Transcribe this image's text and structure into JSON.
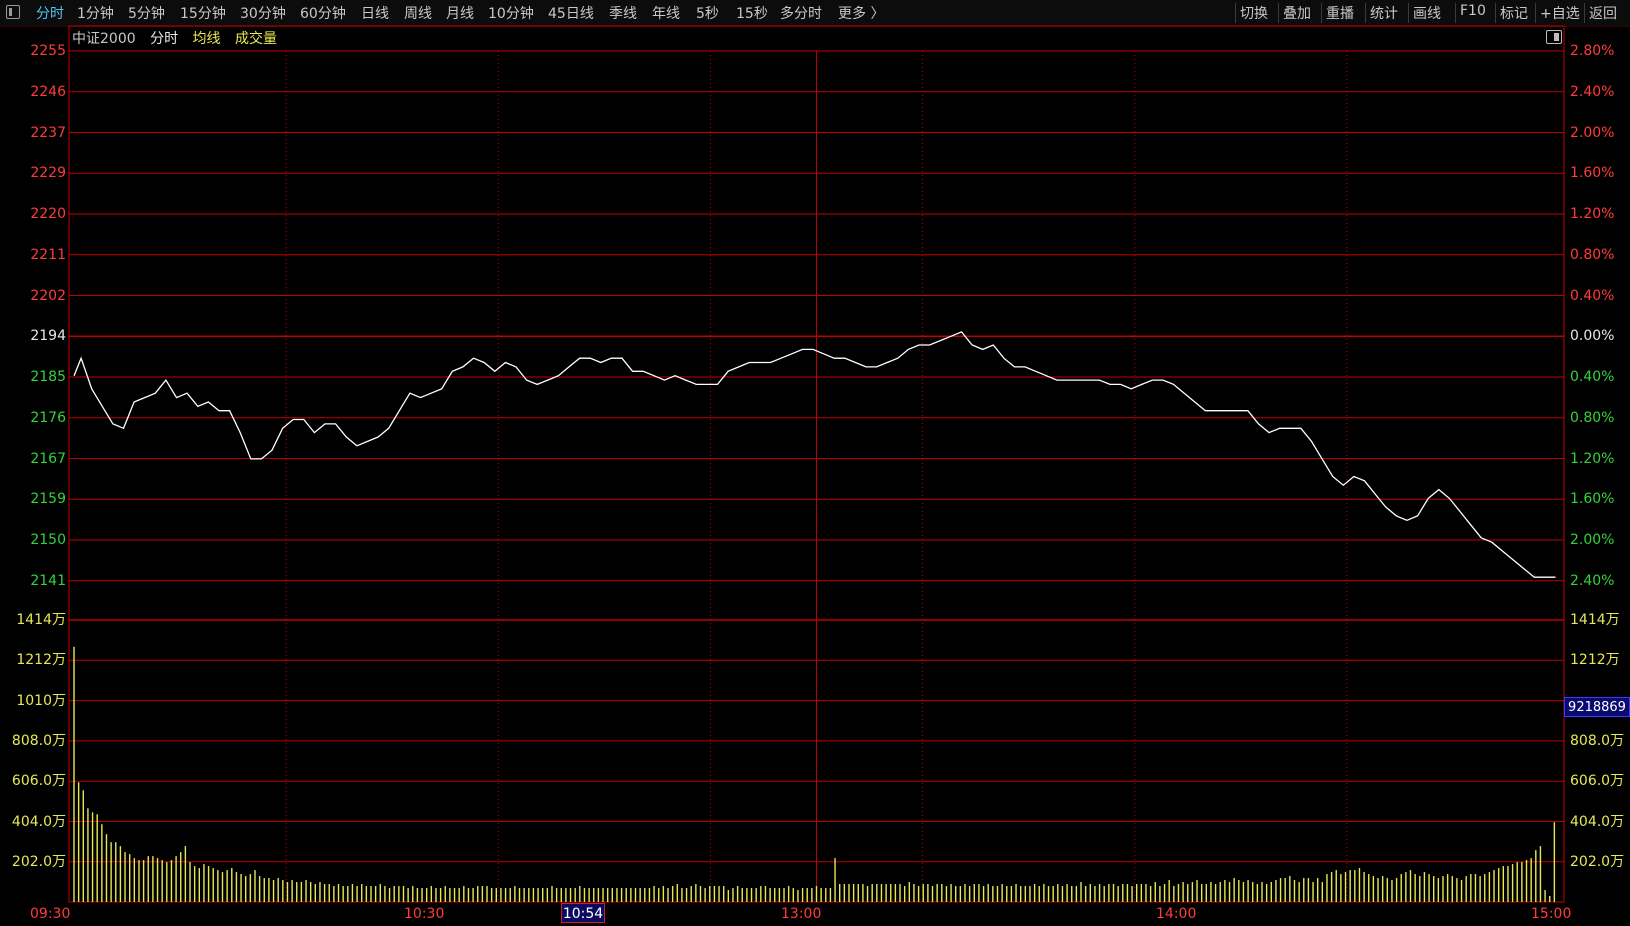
{
  "toolbar": {
    "left_items": [
      "分时",
      "1分钟",
      "5分钟",
      "15分钟",
      "30分钟",
      "60分钟",
      "日线",
      "周线",
      "月线",
      "10分钟",
      "45日线",
      "季线",
      "年线",
      "5秒",
      "15秒",
      "多分时",
      "更多 〉"
    ],
    "active": "分时",
    "right_items": [
      "切换",
      "叠加",
      "重播",
      "统计",
      "画线",
      "F10",
      "标记",
      "+自选",
      "返回"
    ]
  },
  "header": {
    "index_name": "中证2000",
    "mode": "分时",
    "avg_line": "均线",
    "volume": "成交量"
  },
  "colors": {
    "up": "#ff3b3b",
    "down": "#32d23c",
    "flat": "#e8e8e8",
    "volume": "#e8e854",
    "grid": "#c00000",
    "price_line": "#ffffff",
    "active_tab": "#4fc3f7"
  },
  "axes": {
    "price_left": [
      "2255",
      "2246",
      "2237",
      "2229",
      "2220",
      "2211",
      "2202",
      "2194",
      "2185",
      "2176",
      "2167",
      "2159",
      "2150",
      "2141"
    ],
    "price_right": [
      "2.80%",
      "2.40%",
      "2.00%",
      "1.60%",
      "1.20%",
      "0.80%",
      "0.40%",
      "0.00%",
      "0.40%",
      "0.80%",
      "1.20%",
      "1.60%",
      "2.00%",
      "2.40%"
    ],
    "volume_left": [
      "1414万",
      "1212万",
      "1010万",
      "808.0万",
      "606.0万",
      "404.0万",
      "202.0万"
    ],
    "volume_right": [
      "1414万",
      "1212万",
      "1010万",
      "808.0万",
      "606.0万",
      "404.0万",
      "202.0万"
    ],
    "time": [
      "09:30",
      "10:30",
      "13:00",
      "14:00",
      "15:00"
    ]
  },
  "crosshair": {
    "time": "10:54",
    "value": "9218869"
  },
  "chart_data": {
    "type": "line",
    "title": "中证2000 分时",
    "x_session": [
      "09:30",
      "10:30",
      "11:30/13:00",
      "14:00",
      "15:00"
    ],
    "prev_close": 2194,
    "ylim": [
      2132,
      2255
    ],
    "price": [
      [
        0,
        2185
      ],
      [
        2,
        2189
      ],
      [
        5,
        2182
      ],
      [
        8,
        2178
      ],
      [
        11,
        2174
      ],
      [
        14,
        2173
      ],
      [
        17,
        2179
      ],
      [
        20,
        2180
      ],
      [
        23,
        2181
      ],
      [
        26,
        2184
      ],
      [
        29,
        2180
      ],
      [
        32,
        2181
      ],
      [
        35,
        2178
      ],
      [
        38,
        2179
      ],
      [
        41,
        2177
      ],
      [
        44,
        2177
      ],
      [
        47,
        2172
      ],
      [
        50,
        2166
      ],
      [
        53,
        2166
      ],
      [
        56,
        2168
      ],
      [
        59,
        2173
      ],
      [
        62,
        2175
      ],
      [
        65,
        2175
      ],
      [
        68,
        2172
      ],
      [
        71,
        2174
      ],
      [
        74,
        2174
      ],
      [
        77,
        2171
      ],
      [
        80,
        2169
      ],
      [
        83,
        2170
      ],
      [
        86,
        2171
      ],
      [
        89,
        2173
      ],
      [
        92,
        2177
      ],
      [
        95,
        2181
      ],
      [
        98,
        2180
      ],
      [
        101,
        2181
      ],
      [
        104,
        2182
      ],
      [
        107,
        2186
      ],
      [
        110,
        2187
      ],
      [
        113,
        2189
      ],
      [
        116,
        2188
      ],
      [
        119,
        2186
      ],
      [
        122,
        2188
      ],
      [
        125,
        2187
      ],
      [
        128,
        2184
      ],
      [
        131,
        2183
      ],
      [
        134,
        2184
      ],
      [
        137,
        2185
      ],
      [
        140,
        2187
      ],
      [
        143,
        2189
      ],
      [
        146,
        2189
      ],
      [
        149,
        2188
      ],
      [
        152,
        2189
      ],
      [
        155,
        2189
      ],
      [
        158,
        2186
      ],
      [
        161,
        2186
      ],
      [
        164,
        2185
      ],
      [
        167,
        2184
      ],
      [
        170,
        2185
      ],
      [
        173,
        2184
      ],
      [
        176,
        2183
      ],
      [
        179,
        2183
      ],
      [
        182,
        2183
      ],
      [
        185,
        2186
      ],
      [
        188,
        2187
      ],
      [
        191,
        2188
      ],
      [
        194,
        2188
      ],
      [
        197,
        2188
      ],
      [
        200,
        2189
      ],
      [
        203,
        2190
      ],
      [
        206,
        2191
      ],
      [
        209,
        2191
      ],
      [
        212,
        2190
      ],
      [
        215,
        2189
      ],
      [
        218,
        2189
      ],
      [
        221,
        2188
      ],
      [
        224,
        2187
      ],
      [
        227,
        2187
      ],
      [
        230,
        2188
      ],
      [
        233,
        2189
      ],
      [
        236,
        2191
      ],
      [
        239,
        2192
      ],
      [
        242,
        2192
      ],
      [
        245,
        2193
      ],
      [
        248,
        2194
      ],
      [
        251,
        2195
      ],
      [
        254,
        2192
      ],
      [
        257,
        2191
      ],
      [
        260,
        2192
      ],
      [
        263,
        2189
      ],
      [
        266,
        2187
      ],
      [
        269,
        2187
      ],
      [
        272,
        2186
      ],
      [
        275,
        2185
      ],
      [
        278,
        2184
      ],
      [
        281,
        2184
      ],
      [
        284,
        2184
      ],
      [
        287,
        2184
      ],
      [
        290,
        2184
      ],
      [
        293,
        2183
      ],
      [
        296,
        2183
      ],
      [
        299,
        2182
      ],
      [
        302,
        2183
      ],
      [
        305,
        2184
      ],
      [
        308,
        2184
      ],
      [
        311,
        2183
      ],
      [
        314,
        2181
      ],
      [
        317,
        2179
      ],
      [
        320,
        2177
      ],
      [
        323,
        2177
      ],
      [
        326,
        2177
      ],
      [
        329,
        2177
      ],
      [
        332,
        2177
      ],
      [
        335,
        2174
      ],
      [
        338,
        2172
      ],
      [
        341,
        2173
      ],
      [
        344,
        2173
      ],
      [
        347,
        2173
      ],
      [
        350,
        2170
      ],
      [
        353,
        2166
      ],
      [
        356,
        2162
      ],
      [
        359,
        2160
      ],
      [
        362,
        2162
      ],
      [
        365,
        2161
      ],
      [
        368,
        2158
      ],
      [
        371,
        2155
      ],
      [
        374,
        2153
      ],
      [
        377,
        2152
      ],
      [
        380,
        2153
      ],
      [
        383,
        2157
      ],
      [
        386,
        2159
      ],
      [
        389,
        2157
      ],
      [
        392,
        2154
      ],
      [
        395,
        2151
      ],
      [
        398,
        2148
      ],
      [
        401,
        2147
      ],
      [
        404,
        2145
      ],
      [
        407,
        2143
      ],
      [
        410,
        2141
      ],
      [
        413,
        2139
      ],
      [
        416,
        2139
      ],
      [
        419,
        2139
      ]
    ],
    "volume_unit": "万",
    "volume": [
      1280,
      600,
      560,
      470,
      450,
      440,
      390,
      340,
      300,
      300,
      280,
      250,
      240,
      220,
      210,
      210,
      230,
      230,
      220,
      210,
      200,
      210,
      230,
      250,
      280,
      200,
      180,
      170,
      190,
      180,
      170,
      160,
      150,
      160,
      170,
      150,
      140,
      130,
      140,
      160,
      130,
      120,
      120,
      110,
      120,
      110,
      100,
      110,
      100,
      100,
      110,
      100,
      90,
      100,
      90,
      90,
      80,
      90,
      80,
      80,
      90,
      80,
      90,
      80,
      80,
      80,
      90,
      80,
      70,
      80,
      80,
      80,
      70,
      80,
      70,
      70,
      70,
      80,
      70,
      70,
      80,
      70,
      70,
      70,
      80,
      70,
      70,
      80,
      80,
      80,
      70,
      70,
      70,
      70,
      70,
      80,
      70,
      70,
      70,
      70,
      70,
      70,
      70,
      80,
      70,
      70,
      70,
      70,
      70,
      80,
      70,
      70,
      70,
      70,
      70,
      70,
      70,
      70,
      70,
      70,
      70,
      70,
      70,
      70,
      70,
      80,
      70,
      80,
      70,
      80,
      90,
      70,
      70,
      80,
      90,
      80,
      70,
      80,
      80,
      80,
      80,
      60,
      70,
      80,
      70,
      70,
      70,
      70,
      80,
      80,
      70,
      70,
      70,
      70,
      80,
      70,
      60,
      70,
      70,
      70,
      80,
      70,
      70,
      70,
      220,
      90,
      90,
      90,
      90,
      90,
      90,
      80,
      90,
      90,
      90,
      90,
      90,
      90,
      90,
      80,
      100,
      90,
      80,
      90,
      90,
      80,
      90,
      90,
      80,
      90,
      80,
      80,
      90,
      80,
      90,
      90,
      80,
      90,
      80,
      80,
      90,
      80,
      80,
      90,
      80,
      80,
      80,
      90,
      80,
      90,
      80,
      80,
      90,
      80,
      90,
      80,
      80,
      100,
      80,
      90,
      80,
      90,
      80,
      90,
      90,
      80,
      90,
      90,
      80,
      90,
      90,
      90,
      80,
      100,
      80,
      90,
      110,
      80,
      90,
      100,
      90,
      100,
      110,
      90,
      90,
      100,
      90,
      100,
      110,
      100,
      120,
      110,
      100,
      110,
      100,
      90,
      100,
      90,
      100,
      110,
      120,
      120,
      130,
      110,
      100,
      120,
      120,
      100,
      120,
      100,
      140,
      150,
      160,
      140,
      150,
      160,
      160,
      170,
      150,
      140,
      130,
      120,
      130,
      120,
      110,
      120,
      140,
      150,
      160,
      140,
      130,
      150,
      140,
      130,
      120,
      130,
      140,
      130,
      120,
      110,
      130,
      140,
      140,
      130,
      140,
      150,
      160,
      170,
      180,
      180,
      190,
      200,
      200,
      210,
      220,
      260,
      280,
      60,
      30,
      400
    ]
  }
}
